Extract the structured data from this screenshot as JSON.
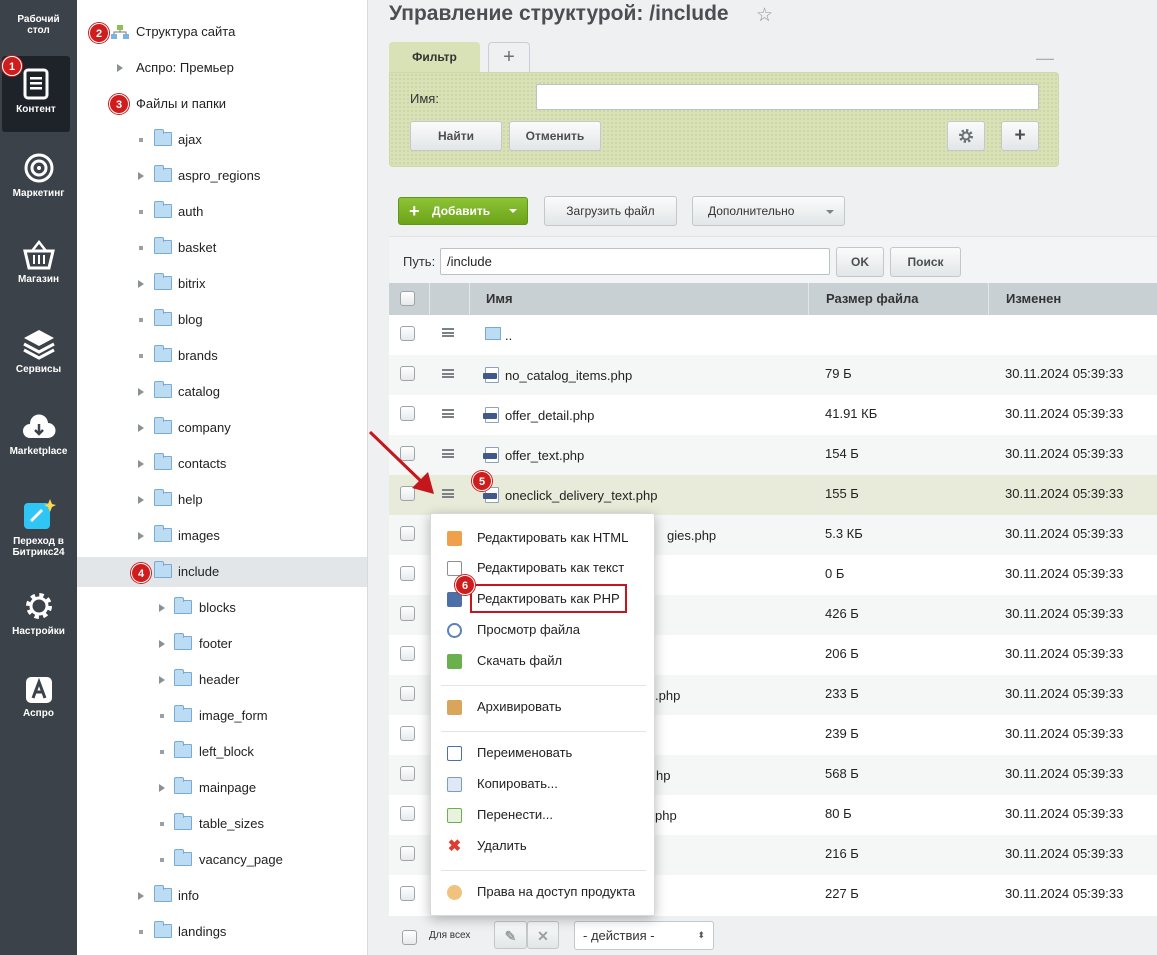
{
  "admin_panel": {
    "items": [
      {
        "label": "Рабочий стол",
        "icon": "desktop-icon"
      },
      {
        "label": "Контент",
        "icon": "content-icon",
        "active": true
      },
      {
        "label": "Маркетинг",
        "icon": "target-icon"
      },
      {
        "label": "Магазин",
        "icon": "basket-icon"
      },
      {
        "label": "Сервисы",
        "icon": "layers-icon"
      },
      {
        "label": "Marketplace",
        "icon": "cloud-download-icon"
      },
      {
        "label": "Переход в Битрикс24",
        "icon": "bitrix24-icon"
      },
      {
        "label": "Настройки",
        "icon": "gear-icon"
      },
      {
        "label": "Аспро",
        "icon": "aspro-icon"
      }
    ],
    "badge": "1"
  },
  "tree": {
    "root": "Структура сайта",
    "root_badge": "2",
    "site": "Аспро: Премьер",
    "files": "Файлы и папки",
    "files_badge": "3",
    "folders": [
      "ajax",
      "aspro_regions",
      "auth",
      "basket",
      "bitrix",
      "blog",
      "brands",
      "catalog",
      "company",
      "contacts",
      "help",
      "images"
    ],
    "selected": "include",
    "selected_badge": "4",
    "subfolders": [
      "blocks",
      "footer",
      "header",
      "image_form",
      "left_block",
      "mainpage",
      "table_sizes",
      "vacancy_page"
    ],
    "after": [
      "info",
      "landings"
    ]
  },
  "header": {
    "title": "Управление структурой: /include"
  },
  "filter": {
    "tab_label": "Фильтр",
    "add_tab": "+",
    "name_label": "Имя:",
    "name_value": "",
    "find_button": "Найти",
    "cancel_button": "Отменить",
    "add_button": "+"
  },
  "toolbar": {
    "add_label": "Добавить",
    "upload_label": "Загрузить файл",
    "more_label": "Дополнительно"
  },
  "path": {
    "label": "Путь:",
    "value": "/include",
    "ok_button": "OK",
    "search_button": "Поиск"
  },
  "table": {
    "columns": [
      "Имя",
      "Размер файла",
      "Изменен"
    ],
    "rows": [
      {
        "name": "..",
        "size": "",
        "date": ""
      },
      {
        "name": "no_catalog_items.php",
        "size": "79 Б",
        "date": "30.11.2024 05:39:33"
      },
      {
        "name": "offer_detail.php",
        "size": "41.91 КБ",
        "date": "30.11.2024 05:39:33"
      },
      {
        "name": "offer_text.php",
        "size": "154 Б",
        "date": "30.11.2024 05:39:33"
      },
      {
        "name": "oneclick_delivery_text.php",
        "size": "155 Б",
        "date": "30.11.2024 05:39:33",
        "badge": "5"
      },
      {
        "name": "gies.php",
        "size": "5.3 КБ",
        "date": "30.11.2024 05:39:33"
      },
      {
        "name": "",
        "size": "0 Б",
        "date": "30.11.2024 05:39:33"
      },
      {
        "name": "",
        "size": "426 Б",
        "date": "30.11.2024 05:39:33"
      },
      {
        "name": "",
        "size": "206 Б",
        "date": "30.11.2024 05:39:33"
      },
      {
        "name": ".php",
        "size": "233 Б",
        "date": "30.11.2024 05:39:33"
      },
      {
        "name": "",
        "size": "239 Б",
        "date": "30.11.2024 05:39:33"
      },
      {
        "name": "hp",
        "size": "568 Б",
        "date": "30.11.2024 05:39:33"
      },
      {
        "name": "php",
        "size": "80 Б",
        "date": "30.11.2024 05:39:33"
      },
      {
        "name": "",
        "size": "216 Б",
        "date": "30.11.2024 05:39:33"
      },
      {
        "name": "",
        "size": "227 Б",
        "date": "30.11.2024 05:39:33"
      }
    ]
  },
  "footer": {
    "for_all": "Для всех",
    "actions": "- действия -"
  },
  "context_menu": {
    "items": [
      {
        "label": "Редактировать как HTML",
        "icon": "html-icon"
      },
      {
        "label": "Редактировать как текст",
        "icon": "txt-icon"
      },
      {
        "label": "Редактировать как PHP",
        "icon": "php-icon",
        "badge": "6"
      },
      {
        "label": "Просмотр файла",
        "icon": "view-icon"
      },
      {
        "label": "Скачать файл",
        "icon": "download-icon"
      },
      {
        "label": "Архивировать",
        "icon": "archive-icon"
      },
      {
        "label": "Переименовать",
        "icon": "rename-icon"
      },
      {
        "label": "Копировать...",
        "icon": "copy-icon"
      },
      {
        "label": "Перенести...",
        "icon": "move-icon"
      },
      {
        "label": "Удалить",
        "icon": "delete-icon"
      },
      {
        "label": "Права на доступ продукта",
        "icon": "access-icon"
      }
    ]
  },
  "colors": {
    "accent_red": "#cf1c1c",
    "add_green": "#7ab326",
    "filter_bg": "#d9e1b6"
  }
}
